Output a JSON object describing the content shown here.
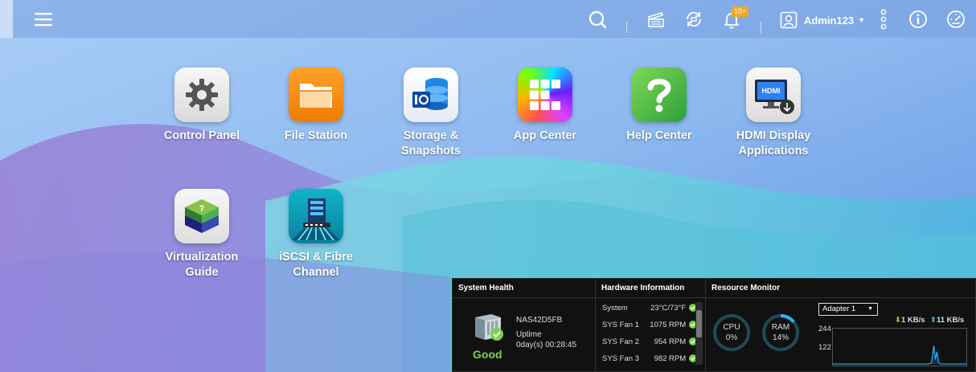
{
  "topbar": {
    "menu_icon": "hamburger-icon",
    "search_icon": "search-icon",
    "tasks_icon": "background-tasks-icon",
    "sync_icon": "sync-devices-icon",
    "notification_icon": "bell-icon",
    "notification_badge": "10+",
    "user_icon": "user-icon",
    "username": "Admin123",
    "more_icon": "more-vertical-icon",
    "info_icon": "info-icon",
    "dashboard_icon": "dashboard-gauge-icon"
  },
  "apps": [
    {
      "label": "Control Panel",
      "icon": "gear-icon"
    },
    {
      "label": "File Station",
      "icon": "folder-icon"
    },
    {
      "label": "Storage &\nSnapshots",
      "icon": "storage-icon"
    },
    {
      "label": "App Center",
      "icon": "app-grid-icon"
    },
    {
      "label": "Help Center",
      "icon": "question-icon"
    },
    {
      "label": "HDMI Display\nApplications",
      "icon": "hdmi-monitor-icon"
    },
    {
      "label": "Virtualization\nGuide",
      "icon": "virtualization-cube-icon"
    },
    {
      "label": "iSCSI & Fibre\nChannel",
      "icon": "iscsi-server-icon"
    }
  ],
  "widget": {
    "system_health": {
      "title": "System Health",
      "nas_name": "NAS42D5FB",
      "uptime_label": "Uptime",
      "uptime_value": "0day(s) 00:28:45",
      "status": "Good",
      "status_color": "#7bd34a"
    },
    "hardware": {
      "title": "Hardware Information",
      "rows": [
        {
          "name": "System",
          "value": "23°C/73°F"
        },
        {
          "name": "SYS Fan 1",
          "value": "1075 RPM"
        },
        {
          "name": "SYS Fan 2",
          "value": "954 RPM"
        },
        {
          "name": "SYS Fan 3",
          "value": "982 RPM"
        }
      ]
    },
    "resource": {
      "title": "Resource Monitor",
      "cpu_label": "CPU",
      "cpu_value": "0%",
      "cpu_fraction": 0,
      "ram_label": "RAM",
      "ram_value": "14%",
      "ram_fraction": 0.14,
      "adapter": "Adapter 1",
      "download": "1 KB/s",
      "upload": "11 KB/s",
      "axis_high": "244",
      "axis_mid": "122",
      "accent": "#29b6f6"
    }
  }
}
